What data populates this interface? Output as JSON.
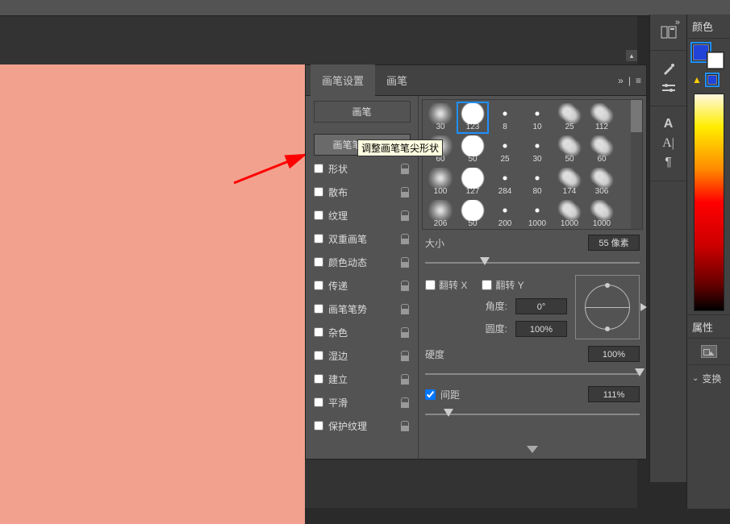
{
  "panel": {
    "tabs": {
      "settings": "画笔设置",
      "brushes": "画笔"
    },
    "top_button": "画笔",
    "tip_shape_button": "画笔笔尖形状",
    "tooltip": "调整画笔笔尖形状",
    "options": [
      {
        "label": "形状"
      },
      {
        "label": "散布"
      },
      {
        "label": "纹理"
      },
      {
        "label": "双重画笔"
      },
      {
        "label": "颜色动态"
      },
      {
        "label": "传递"
      },
      {
        "label": "画笔笔势"
      },
      {
        "label": "杂色"
      },
      {
        "label": "湿边"
      },
      {
        "label": "建立"
      },
      {
        "label": "平滑"
      },
      {
        "label": "保护纹理"
      }
    ]
  },
  "brushes": [
    [
      30,
      123,
      8,
      10,
      25,
      112
    ],
    [
      60,
      50,
      25,
      30,
      50,
      60
    ],
    [
      100,
      127,
      284,
      80,
      174,
      306
    ],
    [
      206,
      50,
      200,
      1000,
      1000,
      1000
    ]
  ],
  "brushes_selected": {
    "row": 0,
    "col": 1
  },
  "ctrl": {
    "size_label": "大小",
    "size_value": "55 像素",
    "flipx": "翻转 X",
    "flipy": "翻转 Y",
    "angle_label": "角度:",
    "angle_value": "0°",
    "round_label": "圆度:",
    "round_value": "100%",
    "hardness_label": "硬度",
    "hardness_value": "100%",
    "spacing_label": "间距",
    "spacing_value": "111%"
  },
  "far": {
    "color_title": "颜色",
    "props_title": "属性",
    "adjust_title": "变换"
  }
}
